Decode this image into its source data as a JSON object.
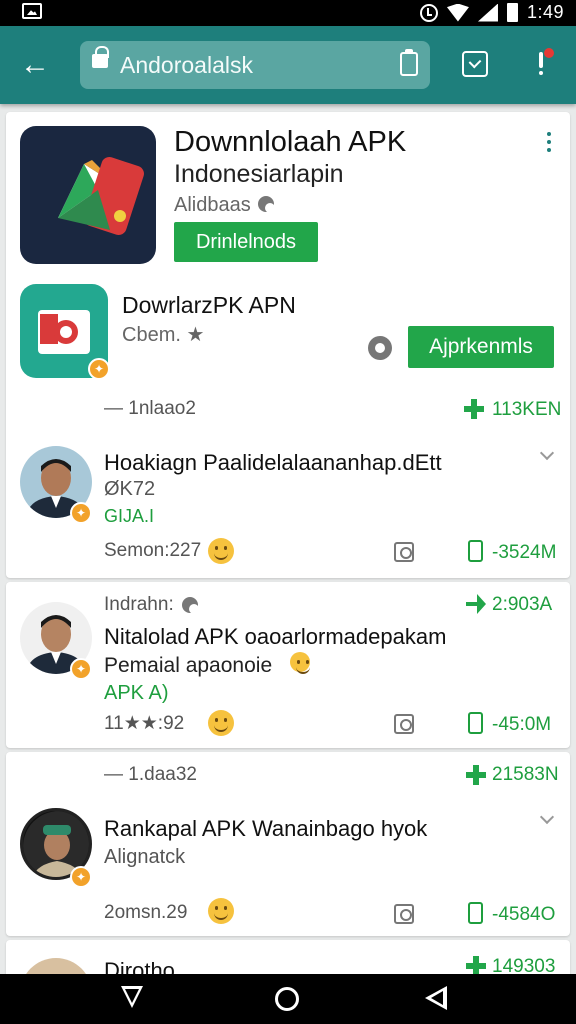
{
  "status_bar": {
    "time": "1:49"
  },
  "browser": {
    "url": "Andoroalalsk"
  },
  "featured": {
    "title": "Downnlolaah APK",
    "subtitle": "Indonesiarlapin",
    "developer": "Alidbaas",
    "button_label": "Drinlelnods"
  },
  "second_app": {
    "title": "DowrlarzPK APN",
    "meta": "Cbem. ★",
    "button_label": "Ajprkenmls"
  },
  "divider1": {
    "left": "— 1nlaao2",
    "right": "113KEN"
  },
  "list": [
    {
      "title": "Hoakiagn Paalidelalaananhap.dEtt",
      "sub": "ØK72",
      "green": "GIJA.I",
      "meta": "Semon:227",
      "size": "-3524M",
      "header": "",
      "header_right": ""
    },
    {
      "title": "Nitalolad APK oaoarlormadepakam",
      "sub": "Pemaial apaonoie",
      "green": "APK A)",
      "meta": "11★★:92",
      "size": "-45:0M",
      "header": "Indrahn:",
      "header_right": "2:903A"
    },
    {
      "title": "Rankapal APK Wanainbago hyok",
      "sub": "Alignatck",
      "green": "",
      "meta": "2omsn.29",
      "size": "-4584O",
      "header": "— 1.daa32",
      "header_right": "21583N"
    },
    {
      "title": "Dirotho",
      "header_right": "149303"
    }
  ]
}
